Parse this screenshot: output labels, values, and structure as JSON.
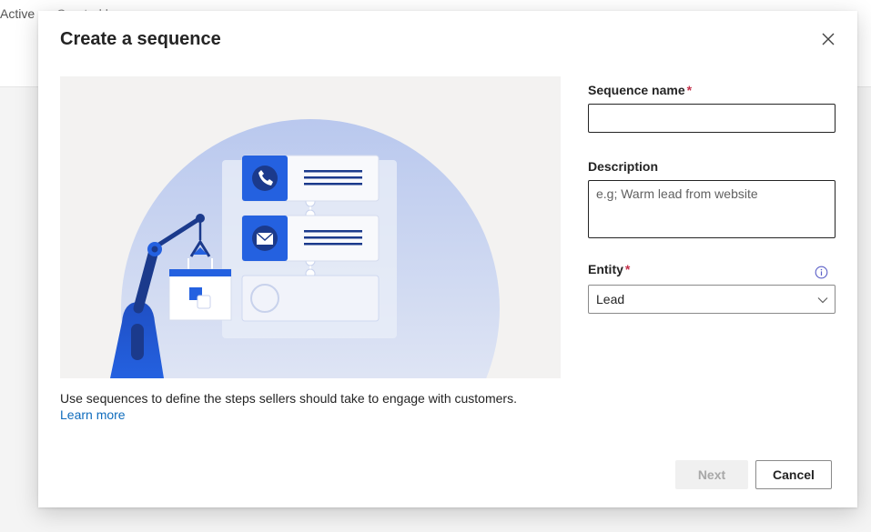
{
  "background": {
    "tab_active": "Active",
    "tab_other": "Created by"
  },
  "dialog": {
    "title": "Create a sequence",
    "close_icon": "close-icon",
    "info_text": "Use sequences to define the steps sellers should take to engage with customers.",
    "learn_more": "Learn more"
  },
  "form": {
    "sequence_name": {
      "label": "Sequence name",
      "required_mark": "*",
      "value": ""
    },
    "description": {
      "label": "Description",
      "placeholder": "e.g; Warm lead from website",
      "value": ""
    },
    "entity": {
      "label": "Entity",
      "required_mark": "*",
      "value": "Lead",
      "info_icon": "info-icon",
      "chevron_icon": "chevron-down-icon"
    }
  },
  "footer": {
    "next_label": "Next",
    "cancel_label": "Cancel"
  },
  "colors": {
    "accent": "#0f6cbd",
    "required": "#c4314b",
    "illustration_blue": "#2461e0",
    "illustration_navy": "#1b3a8c"
  }
}
